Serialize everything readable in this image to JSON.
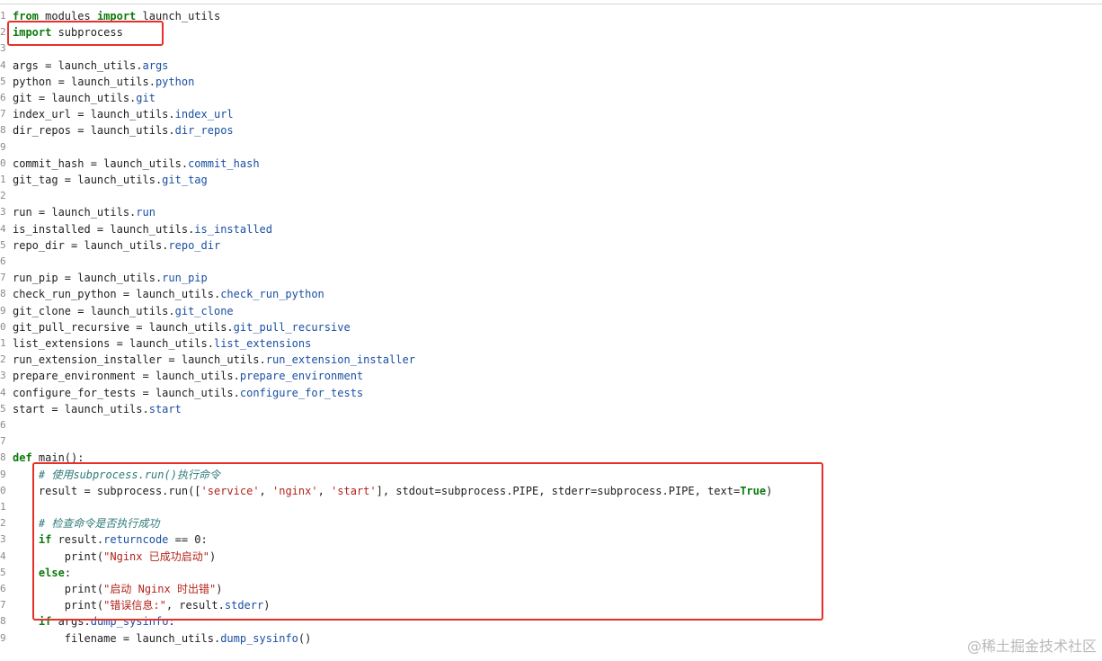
{
  "editor": {
    "lines": [
      {
        "n": "1",
        "tokens": [
          {
            "t": "from",
            "c": "kw"
          },
          {
            "t": " modules ",
            "c": ""
          },
          {
            "t": "import",
            "c": "kw"
          },
          {
            "t": " launch_utils",
            "c": ""
          }
        ]
      },
      {
        "n": "2",
        "tokens": [
          {
            "t": "import",
            "c": "kw"
          },
          {
            "t": " subprocess",
            "c": ""
          }
        ]
      },
      {
        "n": "3",
        "tokens": []
      },
      {
        "n": "4",
        "tokens": [
          {
            "t": "args = launch_utils.",
            "c": ""
          },
          {
            "t": "args",
            "c": "attr"
          }
        ]
      },
      {
        "n": "5",
        "tokens": [
          {
            "t": "python = launch_utils.",
            "c": ""
          },
          {
            "t": "python",
            "c": "attr"
          }
        ]
      },
      {
        "n": "6",
        "tokens": [
          {
            "t": "git = launch_utils.",
            "c": ""
          },
          {
            "t": "git",
            "c": "attr"
          }
        ]
      },
      {
        "n": "7",
        "tokens": [
          {
            "t": "index_url = launch_utils.",
            "c": ""
          },
          {
            "t": "index_url",
            "c": "attr"
          }
        ]
      },
      {
        "n": "8",
        "tokens": [
          {
            "t": "dir_repos = launch_utils.",
            "c": ""
          },
          {
            "t": "dir_repos",
            "c": "attr"
          }
        ]
      },
      {
        "n": "9",
        "tokens": []
      },
      {
        "n": "0",
        "tokens": [
          {
            "t": "commit_hash = launch_utils.",
            "c": ""
          },
          {
            "t": "commit_hash",
            "c": "attr"
          }
        ]
      },
      {
        "n": "1",
        "tokens": [
          {
            "t": "git_tag = launch_utils.",
            "c": ""
          },
          {
            "t": "git_tag",
            "c": "attr"
          }
        ]
      },
      {
        "n": "2",
        "tokens": []
      },
      {
        "n": "3",
        "tokens": [
          {
            "t": "run = launch_utils.",
            "c": ""
          },
          {
            "t": "run",
            "c": "attr"
          }
        ]
      },
      {
        "n": "4",
        "tokens": [
          {
            "t": "is_installed = launch_utils.",
            "c": ""
          },
          {
            "t": "is_installed",
            "c": "attr"
          }
        ]
      },
      {
        "n": "5",
        "tokens": [
          {
            "t": "repo_dir = launch_utils.",
            "c": ""
          },
          {
            "t": "repo_dir",
            "c": "attr"
          }
        ]
      },
      {
        "n": "6",
        "tokens": []
      },
      {
        "n": "7",
        "tokens": [
          {
            "t": "run_pip = launch_utils.",
            "c": ""
          },
          {
            "t": "run_pip",
            "c": "attr"
          }
        ]
      },
      {
        "n": "8",
        "tokens": [
          {
            "t": "check_run_python = launch_utils.",
            "c": ""
          },
          {
            "t": "check_run_python",
            "c": "attr"
          }
        ]
      },
      {
        "n": "9",
        "tokens": [
          {
            "t": "git_clone = launch_utils.",
            "c": ""
          },
          {
            "t": "git_clone",
            "c": "attr"
          }
        ]
      },
      {
        "n": "0",
        "tokens": [
          {
            "t": "git_pull_recursive = launch_utils.",
            "c": ""
          },
          {
            "t": "git_pull_recursive",
            "c": "attr"
          }
        ]
      },
      {
        "n": "1",
        "tokens": [
          {
            "t": "list_extensions = launch_utils.",
            "c": ""
          },
          {
            "t": "list_extensions",
            "c": "attr"
          }
        ]
      },
      {
        "n": "2",
        "tokens": [
          {
            "t": "run_extension_installer = launch_utils.",
            "c": ""
          },
          {
            "t": "run_extension_installer",
            "c": "attr"
          }
        ]
      },
      {
        "n": "3",
        "tokens": [
          {
            "t": "prepare_environment = launch_utils.",
            "c": ""
          },
          {
            "t": "prepare_environment",
            "c": "attr"
          }
        ]
      },
      {
        "n": "4",
        "tokens": [
          {
            "t": "configure_for_tests = launch_utils.",
            "c": ""
          },
          {
            "t": "configure_for_tests",
            "c": "attr"
          }
        ]
      },
      {
        "n": "5",
        "tokens": [
          {
            "t": "start = launch_utils.",
            "c": ""
          },
          {
            "t": "start",
            "c": "attr"
          }
        ]
      },
      {
        "n": "6",
        "tokens": []
      },
      {
        "n": "7",
        "tokens": []
      },
      {
        "n": "8",
        "tokens": [
          {
            "t": "def",
            "c": "kw"
          },
          {
            "t": " main():",
            "c": ""
          }
        ]
      },
      {
        "n": "9",
        "tokens": [
          {
            "t": "    ",
            "c": ""
          },
          {
            "t": "# 使用subprocess.run()执行命令",
            "c": "cm"
          }
        ]
      },
      {
        "n": "0",
        "tokens": [
          {
            "t": "    result = subprocess.run([",
            "c": ""
          },
          {
            "t": "'service'",
            "c": "str"
          },
          {
            "t": ", ",
            "c": ""
          },
          {
            "t": "'nginx'",
            "c": "str"
          },
          {
            "t": ", ",
            "c": ""
          },
          {
            "t": "'start'",
            "c": "str"
          },
          {
            "t": "], stdout=subprocess.PIPE, stderr=subprocess.PIPE, text=",
            "c": ""
          },
          {
            "t": "True",
            "c": "kw"
          },
          {
            "t": ")",
            "c": ""
          }
        ]
      },
      {
        "n": "1",
        "tokens": []
      },
      {
        "n": "2",
        "tokens": [
          {
            "t": "    ",
            "c": ""
          },
          {
            "t": "# 检查命令是否执行成功",
            "c": "cm"
          }
        ]
      },
      {
        "n": "3",
        "tokens": [
          {
            "t": "    ",
            "c": ""
          },
          {
            "t": "if",
            "c": "kw"
          },
          {
            "t": " result.",
            "c": ""
          },
          {
            "t": "returncode",
            "c": "attr"
          },
          {
            "t": " == 0:",
            "c": ""
          }
        ]
      },
      {
        "n": "4",
        "tokens": [
          {
            "t": "        print(",
            "c": ""
          },
          {
            "t": "\"Nginx 已成功启动\"",
            "c": "str"
          },
          {
            "t": ")",
            "c": ""
          }
        ]
      },
      {
        "n": "5",
        "tokens": [
          {
            "t": "    ",
            "c": ""
          },
          {
            "t": "else",
            "c": "kw"
          },
          {
            "t": ":",
            "c": ""
          }
        ]
      },
      {
        "n": "6",
        "tokens": [
          {
            "t": "        print(",
            "c": ""
          },
          {
            "t": "\"启动 Nginx 时出错\"",
            "c": "str"
          },
          {
            "t": ")",
            "c": ""
          }
        ]
      },
      {
        "n": "7",
        "tokens": [
          {
            "t": "        print(",
            "c": ""
          },
          {
            "t": "\"错误信息:\"",
            "c": "str"
          },
          {
            "t": ", result.",
            "c": ""
          },
          {
            "t": "stderr",
            "c": "attr"
          },
          {
            "t": ")",
            "c": ""
          }
        ]
      },
      {
        "n": "8",
        "tokens": [
          {
            "t": "    ",
            "c": ""
          },
          {
            "t": "if",
            "c": "kw"
          },
          {
            "t": " args.",
            "c": ""
          },
          {
            "t": "dump_sysinfo",
            "c": "attr"
          },
          {
            "t": ":",
            "c": ""
          }
        ]
      },
      {
        "n": "9",
        "tokens": [
          {
            "t": "        filename = launch_utils.",
            "c": ""
          },
          {
            "t": "dump_sysinfo",
            "c": "attr"
          },
          {
            "t": "()",
            "c": ""
          }
        ]
      }
    ]
  },
  "colors": {
    "annotation": "#e8302a",
    "keyword": "#0b7a0b",
    "attribute": "#1a4fa3",
    "string": "#b3241c",
    "comment": "#2f7a7a"
  },
  "watermark": "@稀土掘金技术社区"
}
